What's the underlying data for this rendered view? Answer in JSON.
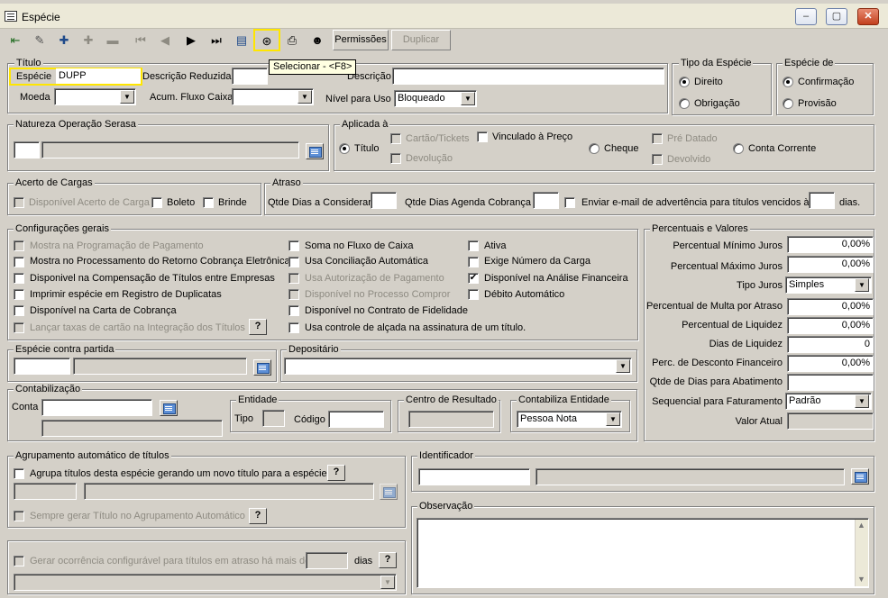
{
  "window": {
    "title": "Espécie",
    "min": "–",
    "max": "▢",
    "close": "✕"
  },
  "toolbar": {
    "permissoes": "Permissões",
    "duplicar": "Duplicar",
    "tooltip": "Selecionar - <F8>"
  },
  "titulo": {
    "group": "Título",
    "especie_label": "Espécie",
    "especie_value": "DUPP",
    "desc_reduzida_label": "Descrição Reduzida",
    "descricao_label": "Descrição",
    "moeda_label": "Moeda",
    "acum_label": "Acum. Fluxo Caixa",
    "nivel_label": "Nível para Uso",
    "nivel_value": "Bloqueado"
  },
  "tipo_especie": {
    "group": "Tipo da Espécie",
    "direito": "Direito",
    "obrigacao": "Obrigação"
  },
  "especie_de": {
    "group": "Espécie de",
    "confirmacao": "Confirmação",
    "provisao": "Provisão"
  },
  "natureza": {
    "group": "Natureza Operação Serasa"
  },
  "aplicada": {
    "group": "Aplicada à",
    "titulo": "Título",
    "cartao": "Cartão/Tickets",
    "vinculado": "Vinculado à Preço",
    "devolucao": "Devolução",
    "cheque": "Cheque",
    "pre_datado": "Pré Datado",
    "devolvido": "Devolvido",
    "conta_corrente": "Conta Corrente"
  },
  "acerto": {
    "group": "Acerto de Cargas",
    "disponivel": "Disponível Acerto de Carga",
    "boleto": "Boleto",
    "brinde": "Brinde"
  },
  "atraso": {
    "group": "Atraso",
    "qtde_dias": "Qtde Dias a Considerar",
    "qtde_agenda": "Qtde Dias Agenda Cobrança",
    "enviar": "Enviar e-mail de advertência para títulos vencidos à",
    "dias": "dias."
  },
  "config": {
    "group": "Configurações gerais",
    "items": [
      "Mostra na Programação de Pagamento",
      "Mostra no Processamento do Retorno Cobrança Eletrônica",
      "Disponivel na Compensação de Títulos entre Empresas",
      "Imprimir espécie em Registro de Duplicatas",
      "Disponível na Carta de Cobrança",
      "Lançar taxas de cartão na Integração dos Títulos",
      "Soma no Fluxo de Caixa",
      "Usa Conciliação Automática",
      "Usa Autorização de Pagamento",
      "Disponível no Processo Compror",
      "Disponível no Contrato de Fidelidade",
      "Usa controle de alçada na assinatura de um título.",
      "Ativa",
      "Exige Número da Carga",
      "Disponível na Análise Financeira",
      "Débito Automático"
    ],
    "help": "?"
  },
  "percentuais": {
    "group": "Percentuais e Valores",
    "rows": [
      {
        "label": "Percentual Mínimo Juros",
        "value": "0,00%"
      },
      {
        "label": "Percentual Máximo Juros",
        "value": "0,00%"
      },
      {
        "label": "Tipo Juros",
        "value": "Simples"
      },
      {
        "label": "Percentual de Multa por Atraso",
        "value": "0,00%"
      },
      {
        "label": "Percentual de Liquidez",
        "value": "0,00%"
      },
      {
        "label": "Dias de Liquidez",
        "value": "0"
      },
      {
        "label": "Perc. de Desconto Financeiro",
        "value": "0,00%"
      },
      {
        "label": "Qtde de Dias para Abatimento",
        "value": ""
      },
      {
        "label": "Sequencial para Faturamento",
        "value": "Padrão"
      },
      {
        "label": "Valor Atual",
        "value": ""
      }
    ]
  },
  "contra_partida": {
    "group": "Espécie contra partida"
  },
  "depositario": {
    "group": "Depositário"
  },
  "contabilizacao": {
    "group": "Contabilização",
    "conta": "Conta"
  },
  "entidade": {
    "group": "Entidade",
    "tipo": "Tipo",
    "codigo": "Código"
  },
  "centro": {
    "group": "Centro de Resultado"
  },
  "contab_entidade": {
    "group": "Contabiliza Entidade",
    "value": "Pessoa Nota"
  },
  "agrupamento": {
    "group": "Agrupamento automático de títulos",
    "agrupa": "Agrupa títulos desta espécie gerando um novo título para a espécie",
    "sempre": "Sempre gerar Título no  Agrupamento Automático"
  },
  "identificador": {
    "group": "Identificador"
  },
  "observacao": {
    "group": "Observação"
  },
  "ocorrencia": {
    "label": "Gerar ocorrência configurável para títulos em atraso há mais de",
    "dias": "dias"
  }
}
